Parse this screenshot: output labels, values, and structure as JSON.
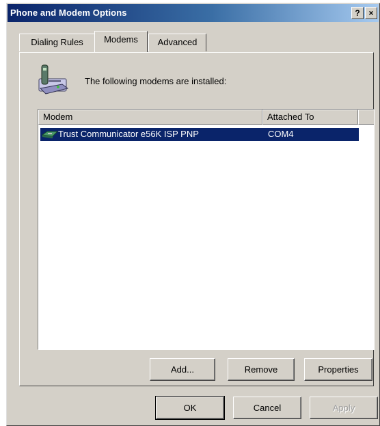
{
  "window": {
    "title": "Phone and Modem Options",
    "help_glyph": "?",
    "close_glyph": "×"
  },
  "tabs": [
    {
      "label": "Dialing Rules",
      "active": false
    },
    {
      "label": "Modems",
      "active": true
    },
    {
      "label": "Advanced",
      "active": false
    }
  ],
  "panel": {
    "intro": "The following modems are installed:",
    "icon": "phone-modem-icon"
  },
  "listview": {
    "columns": [
      "Modem",
      "Attached To"
    ],
    "rows": [
      {
        "icon": "modem-icon",
        "name": "Trust Communicator e56K ISP PNP",
        "attached_to": "COM4",
        "selected": true
      }
    ]
  },
  "panel_buttons": {
    "add": "Add...",
    "remove": "Remove",
    "properties": "Properties"
  },
  "dialog_buttons": {
    "ok": "OK",
    "cancel": "Cancel",
    "apply": "Apply"
  },
  "colors": {
    "title_start": "#0a246a",
    "title_end": "#a6caf0",
    "selection": "#0a246a",
    "face": "#d4d0c8"
  }
}
